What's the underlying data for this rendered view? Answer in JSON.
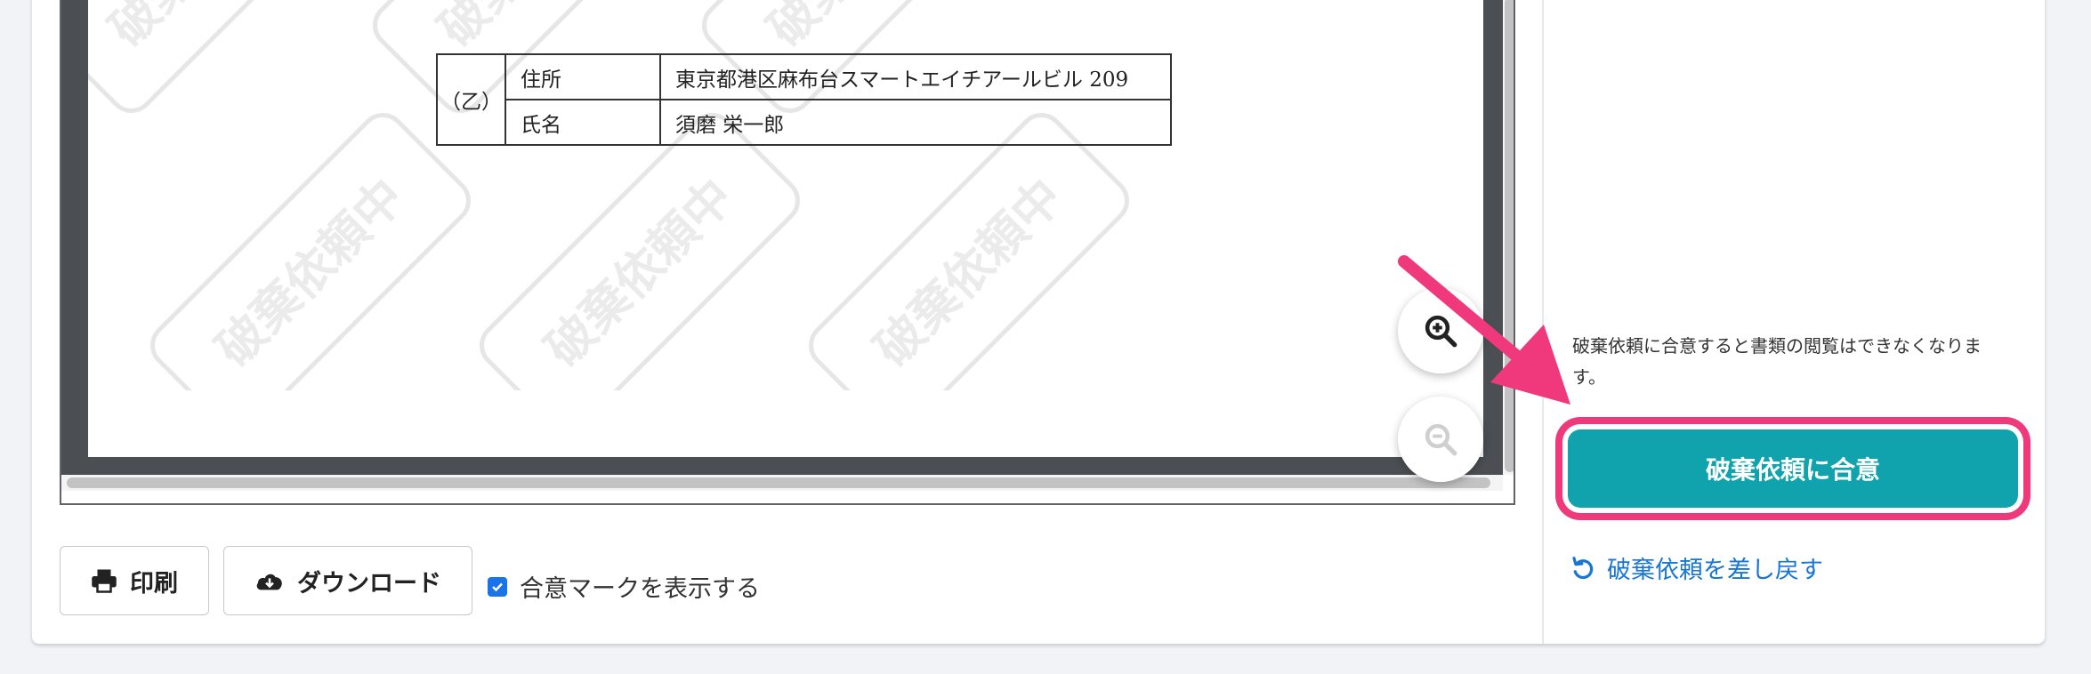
{
  "document": {
    "watermark_text": "破棄依頼中",
    "party_table": {
      "role": "（乙）",
      "rows": [
        {
          "key": "住所",
          "value": "東京都港区麻布台スマートエイチアールビル 209"
        },
        {
          "key": "氏名",
          "value": "須磨 栄一郎"
        }
      ]
    }
  },
  "viewer_controls": {
    "zoom_in_icon": "zoom-in-icon",
    "zoom_out_icon": "zoom-out-icon"
  },
  "footer": {
    "print_label": "印刷",
    "download_label": "ダウンロード",
    "show_agree_mark_label": "合意マークを表示する",
    "show_agree_mark_checked": true
  },
  "side_panel": {
    "notice": "破棄依頼に合意すると書類の閲覧はできなくなります。",
    "agree_button_label": "破棄依頼に合意",
    "revert_link_label": "破棄依頼を差し戻す"
  },
  "colors": {
    "accent_teal": "#10a3ad",
    "highlight_pink": "#f0387c",
    "link_blue": "#1976d2",
    "checkbox_blue": "#1a73e8"
  }
}
